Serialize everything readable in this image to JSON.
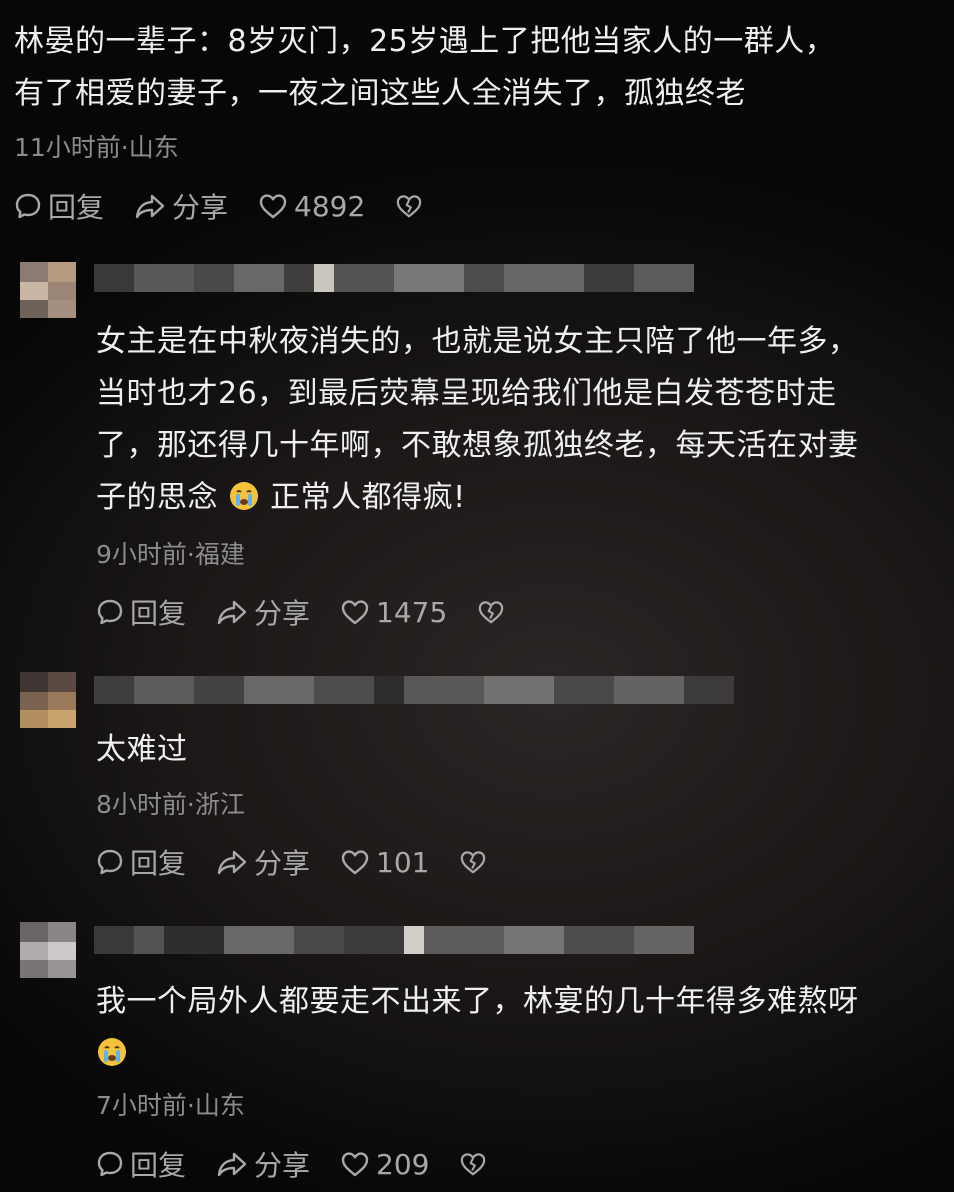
{
  "post": {
    "lines": [
      "林晏的一辈子：8岁灭门，25岁遇上了把他当家人的一群人，",
      "有了相爱的妻子，一夜之间这些人全消失了，孤独终老"
    ],
    "meta": "11小时前·山东",
    "reply_label": "回复",
    "share_label": "分享",
    "likes": "4892"
  },
  "comments": [
    {
      "lines": [
        "女主是在中秋夜消失的，也就是说女主只陪了他一年多，",
        "当时也才26，到最后荧幕呈现给我们他是白发苍苍时走",
        "了，那还得几十年啊，不敢想象孤独终老，每天活在对妻",
        "子的思念",
        "正常人都得疯!"
      ],
      "meta": "9小时前·福建",
      "reply_label": "回复",
      "share_label": "分享",
      "likes": "1475"
    },
    {
      "lines": [
        "太难过"
      ],
      "meta": "8小时前·浙江",
      "reply_label": "回复",
      "share_label": "分享",
      "likes": "101"
    },
    {
      "lines": [
        "我一个局外人都要走不出来了，林宴的几十年得多难熬呀"
      ],
      "meta": "7小时前·山东",
      "reply_label": "回复",
      "share_label": "分享",
      "likes": "209"
    }
  ],
  "icons": {
    "reply": "speech-bubble-icon",
    "share": "share-arrow-icon",
    "like": "heart-icon",
    "dislike": "broken-heart-icon",
    "emoji": "crying-face-emoji"
  },
  "colors": {
    "text": "#efefef",
    "meta": "#8c8c8c",
    "action": "#a8a8a8",
    "background": "#1a1716"
  }
}
